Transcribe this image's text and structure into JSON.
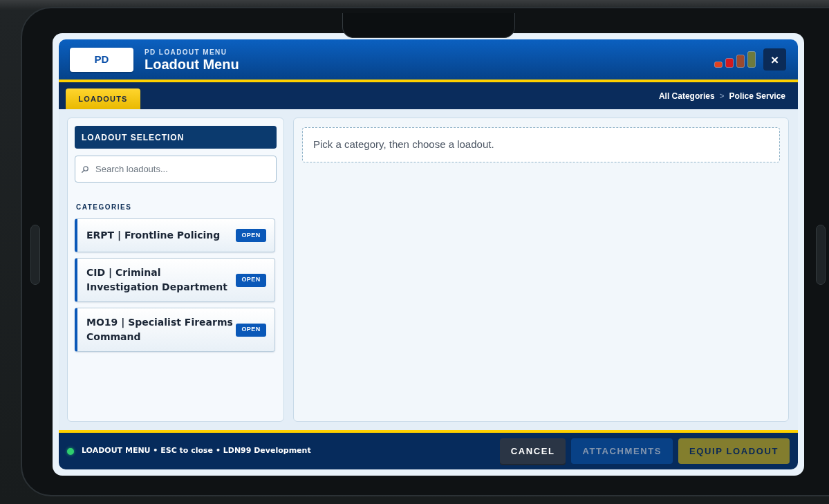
{
  "header": {
    "logo": "PD",
    "subtitle": "PD LOADOUT MENU",
    "title": "Loadout Menu",
    "close": "×"
  },
  "tabs": [
    {
      "label": "LOADOUTS",
      "selected": true
    }
  ],
  "breadcrumb": {
    "items": [
      "All Categories",
      "Police Service"
    ],
    "separator": ">"
  },
  "sidebar": {
    "title": "LOADOUT SELECTION",
    "search": {
      "placeholder": "Search loadouts..."
    },
    "categories_label": "CATEGORIES",
    "categories": [
      {
        "name": "ERPT | Frontline Policing",
        "action": "OPEN"
      },
      {
        "name": "CID | Criminal Investigation Department",
        "action": "OPEN"
      },
      {
        "name": "MO19 | Specialist Firearms Command",
        "action": "OPEN"
      }
    ]
  },
  "main": {
    "hint": "Pick a category, then choose a loadout."
  },
  "status_bar": {
    "text": "LOADOUT MENU • ESC to close • LDN99 Development"
  },
  "buttons": [
    {
      "label": "CANCEL",
      "kind": "cancel",
      "disabled": false
    },
    {
      "label": "ATTACHMENTS",
      "kind": "secondary",
      "disabled": true
    },
    {
      "label": "EQUIP LOADOUT",
      "kind": "primary",
      "disabled": true
    }
  ]
}
